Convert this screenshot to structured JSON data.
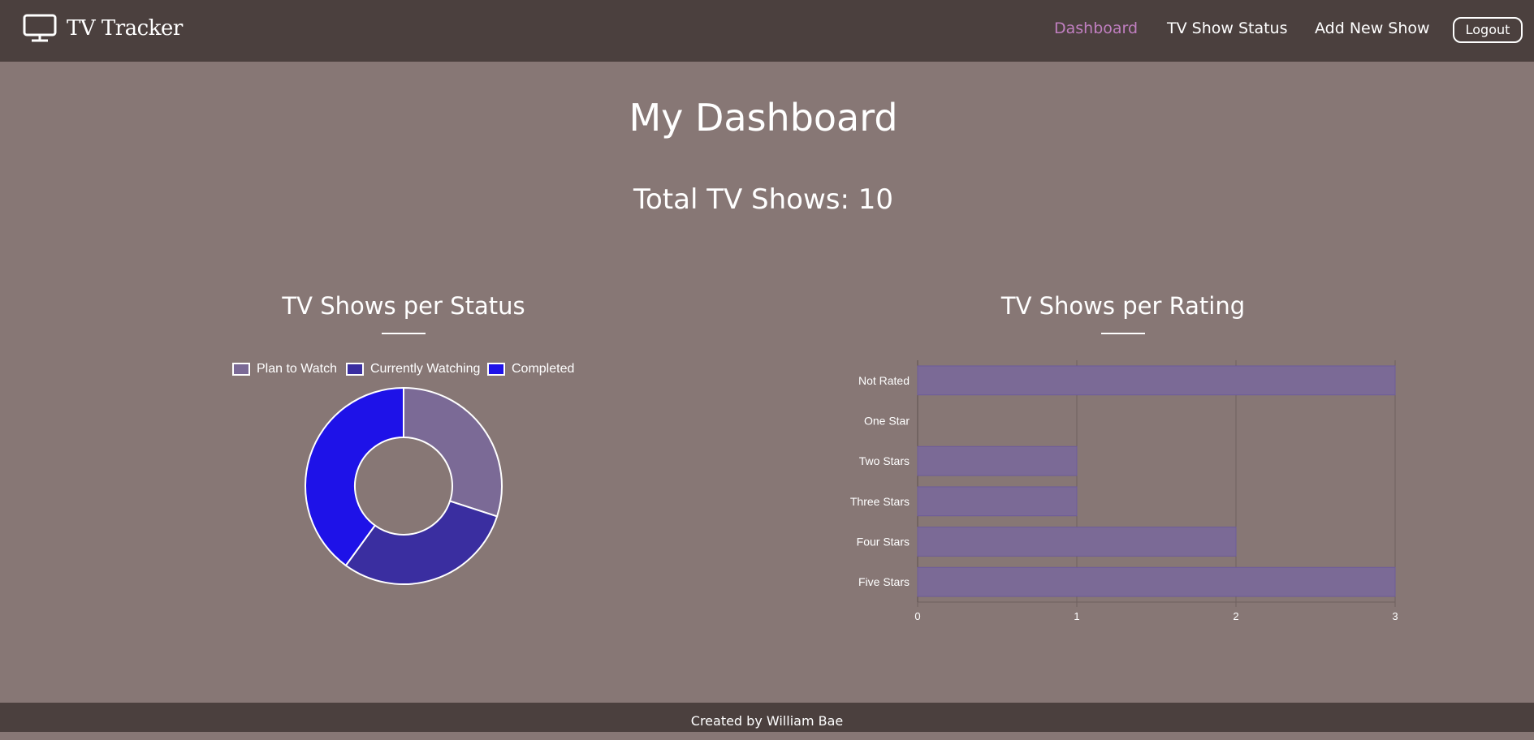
{
  "app": {
    "name": "TV Tracker"
  },
  "nav": {
    "dashboard": "Dashboard",
    "status": "TV Show Status",
    "add": "Add New Show",
    "logout": "Logout"
  },
  "page": {
    "title": "My Dashboard",
    "total": "Total TV Shows: 10"
  },
  "colors": {
    "navbar": "#4b403e",
    "background": "#877775",
    "active_link": "#c07fc0",
    "plan_to_watch": "#7b6a96",
    "currently_watching": "#3a2ea0",
    "completed": "#1e12e8",
    "bar_fill": "#7b6a96"
  },
  "status_chart": {
    "title": "TV Shows per Status",
    "chart_data": {
      "type": "pie",
      "categories": [
        "Plan to Watch",
        "Currently Watching",
        "Completed"
      ],
      "values": [
        3,
        3,
        4
      ],
      "legend_position": "top"
    }
  },
  "rating_chart": {
    "title": "TV Shows per Rating",
    "chart_data": {
      "type": "bar",
      "orientation": "horizontal",
      "categories": [
        "Not Rated",
        "One Star",
        "Two Stars",
        "Three Stars",
        "Four Stars",
        "Five Stars"
      ],
      "values": [
        3,
        0,
        1,
        1,
        2,
        3
      ],
      "xlim": [
        0,
        3
      ],
      "xticks": [
        "0",
        "1",
        "2",
        "3"
      ],
      "grid": true
    }
  },
  "footer": {
    "text": "Created by William Bae"
  }
}
